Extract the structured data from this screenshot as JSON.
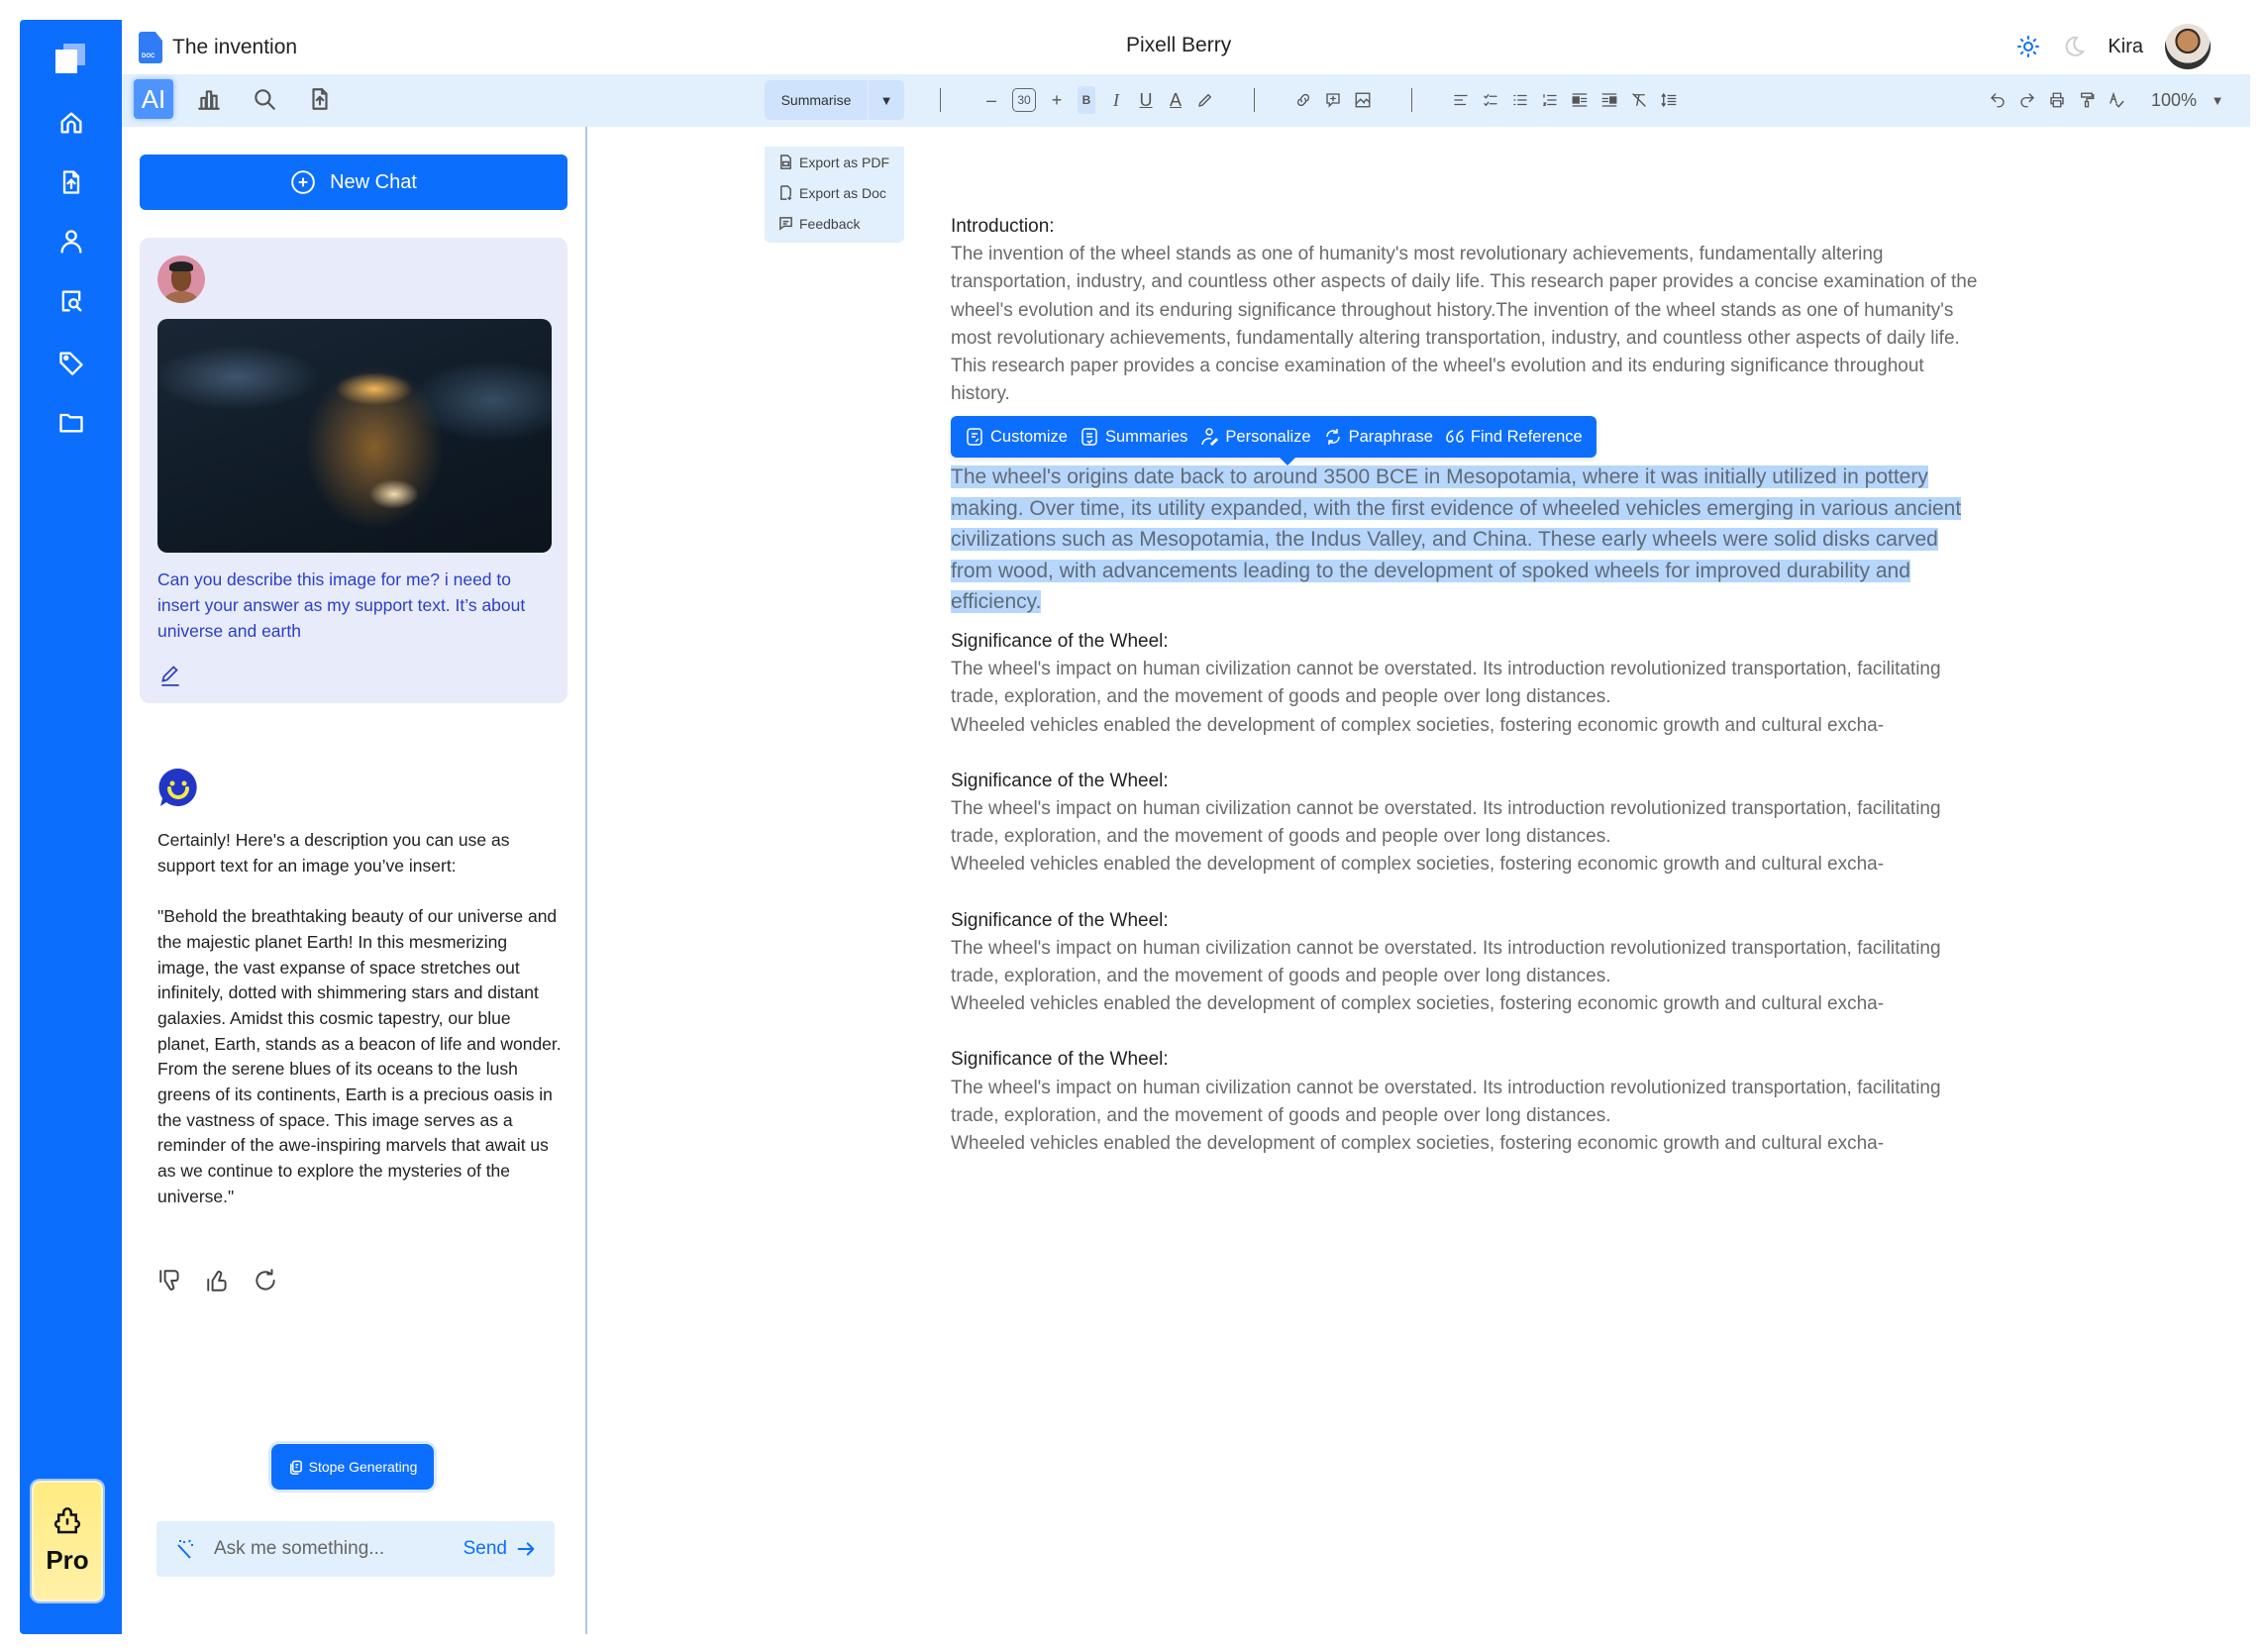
{
  "header": {
    "doc_title": "The invention",
    "doc_icon_label": "DOC",
    "app_name": "Pixell Berry",
    "user_name": "Kira",
    "theme_light_icon": "sun-icon",
    "theme_dark_icon": "moon-icon"
  },
  "nav": {
    "items": [
      {
        "name": "home",
        "icon": "home-icon"
      },
      {
        "name": "upload",
        "icon": "file-upload-icon"
      },
      {
        "name": "profile",
        "icon": "user-icon"
      },
      {
        "name": "search-docs",
        "icon": "doc-search-icon"
      },
      {
        "name": "tags",
        "icon": "tag-icon"
      },
      {
        "name": "folder",
        "icon": "folder-icon"
      }
    ],
    "pro_label": "Pro"
  },
  "panel_tabs": [
    {
      "label": "AI",
      "active": true
    },
    {
      "icon": "chart-icon"
    },
    {
      "icon": "search-icon"
    },
    {
      "icon": "file-upload-icon"
    }
  ],
  "toolbar": {
    "mode_label": "Summarise",
    "mode_menu": [
      {
        "label": "Export as PDF",
        "icon": "pdf-icon"
      },
      {
        "label": "Export as Doc",
        "icon": "doc-icon"
      },
      {
        "label": "Feedback",
        "icon": "feedback-icon"
      }
    ],
    "font_size": "30",
    "bold_label": "B",
    "zoom": "100%",
    "accent": "#0c6efd",
    "bar_bg": "#e2effd"
  },
  "chat": {
    "new_chat_label": "New Chat",
    "user_message": "Can you describe this image for me? i need to insert your answer as my support text. It’s about universe and earth",
    "bot_intro": "Certainly! Here's a description you can use as support text for an image you’ve insert:",
    "bot_body": "\"Behold the breathtaking beauty of our universe and the majestic planet Earth! In this mesmerizing image, the vast expanse of space stretches out infinitely, dotted with shimmering stars and distant galaxies. Amidst this cosmic tapestry, our blue planet, Earth, stands as a beacon of life and wonder. From the serene blues of its oceans to the lush greens of its continents, Earth is a precious oasis in the vastness of space. This image serves as a reminder of the awe-inspiring marvels that await us as we continue to explore the mysteries of the universe.\"",
    "stop_label": "Stope Generating",
    "input_placeholder": "Ask me something...",
    "send_label": "Send"
  },
  "ai_actions": [
    {
      "label": "Customize",
      "icon": "customize-icon"
    },
    {
      "label": "Summaries",
      "icon": "summaries-icon"
    },
    {
      "label": "Personalize",
      "icon": "personalize-icon"
    },
    {
      "label": "Paraphrase",
      "icon": "paraphrase-icon"
    },
    {
      "label": "Find Reference",
      "icon": "quote-icon"
    }
  ],
  "document": {
    "intro_heading": "Introduction:",
    "intro_text": "The invention of the wheel stands as one of humanity's most revolutionary achievements, fundamentally altering transportation, industry, and countless other aspects of daily life. This research paper provides a concise examination of the wheel's evolution and its enduring significance throughout history.The invention of the wheel stands as one of humanity's most revolutionary achievements, fundamentally altering transportation, industry, and countless other aspects of daily life. This research paper provides a concise examination of the wheel's evolution and its enduring significance throughout history.",
    "selected_text": "The wheel's origins date back to around 3500 BCE in Mesopotamia, where it was initially utilized in pottery making. Over time, its utility expanded, with the first evidence of wheeled vehicles emerging in various ancient civilizations such as Mesopotamia, the Indus Valley, and China. These early wheels were solid disks carved from wood, with advancements leading to the development of spoked wheels for improved durability and efficiency.",
    "sections": [
      {
        "heading": "Significance of the Wheel:",
        "p1": "The wheel's impact on human civilization cannot be overstated. Its introduction revolutionized transportation, facilitating trade, exploration, and the movement of goods and people over long distances.",
        "p2": "Wheeled vehicles enabled the development of complex societies, fostering economic growth and cultural excha-"
      },
      {
        "heading": "Significance of the Wheel:",
        "p1": "The wheel's impact on human civilization cannot be overstated. Its introduction revolutionized transportation, facilitating trade, exploration, and the movement of goods and people over long distances.",
        "p2": "Wheeled vehicles enabled the development of complex societies, fostering economic growth and cultural excha-"
      },
      {
        "heading": "Significance of the Wheel:",
        "p1": "The wheel's impact on human civilization cannot be overstated. Its introduction revolutionized transportation, facilitating trade, exploration, and the movement of goods and people over long distances.",
        "p2": "Wheeled vehicles enabled the development of complex societies, fostering economic growth and cultural excha-"
      },
      {
        "heading": "Significance of the Wheel:",
        "p1": "The wheel's impact on human civilization cannot be overstated. Its introduction revolutionized transportation, facilitating trade, exploration, and the movement of goods and people over long distances.",
        "p2": "Wheeled vehicles enabled the development of complex societies, fostering economic growth and cultural excha-"
      }
    ]
  }
}
